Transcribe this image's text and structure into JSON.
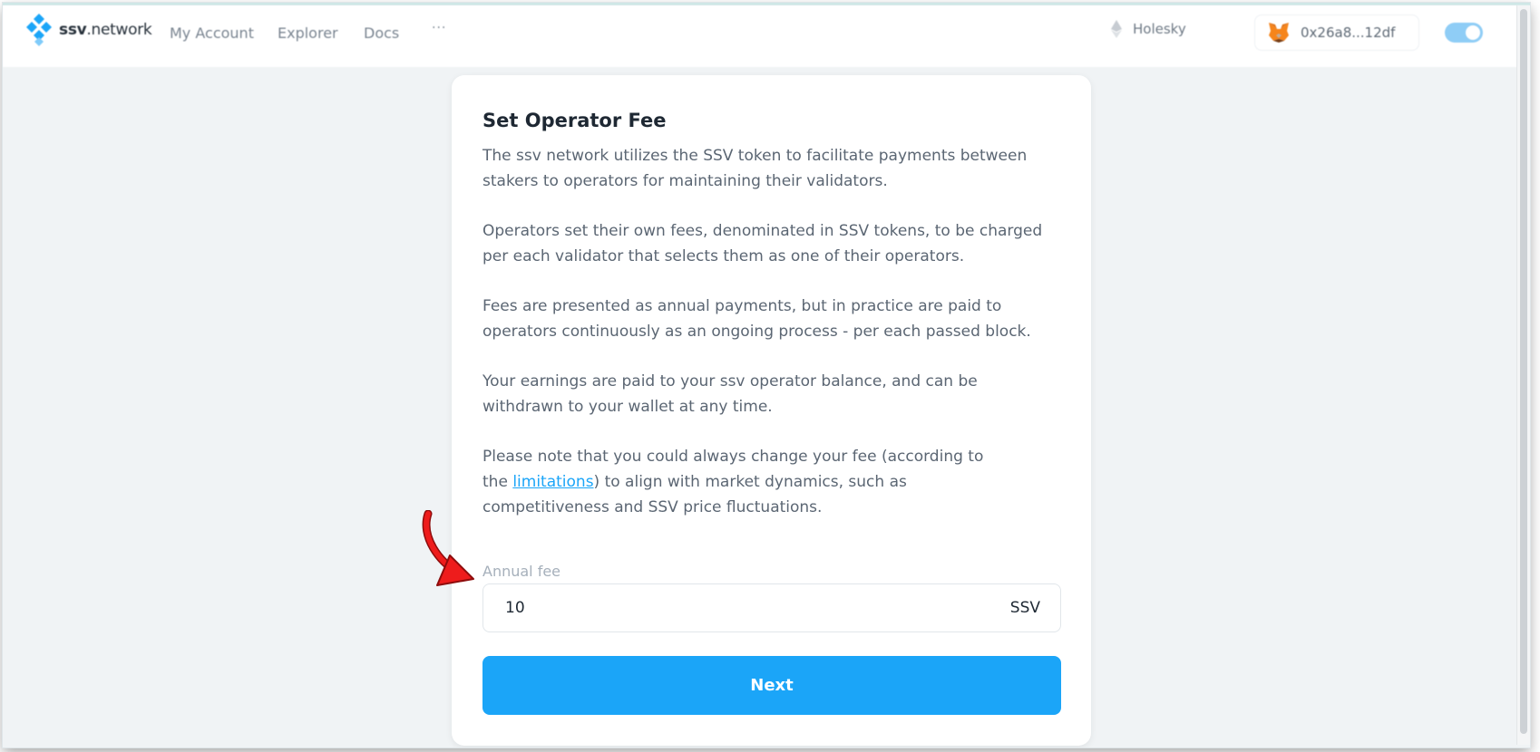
{
  "header": {
    "logo_bold": "ssv",
    "logo_rest": ".network",
    "nav": [
      "My Account",
      "Explorer",
      "Docs",
      "···"
    ],
    "network": "Holesky",
    "wallet_address": "0x26a8...12df"
  },
  "card": {
    "title": "Set Operator Fee",
    "paragraphs": [
      "The ssv network utilizes the SSV token to facilitate payments between stakers to operators for maintaining their validators.",
      "Operators set their own fees, denominated in SSV tokens, to be charged per each validator that selects them as one of their operators.",
      "Fees are presented as annual payments, but in practice are paid to operators continuously as an ongoing process - per each passed block.",
      "Your earnings are paid to your ssv operator balance, and can be withdrawn to your wallet at any time."
    ],
    "note": {
      "before": "Please note that you could always change your fee (according to the ",
      "link": "limitations",
      "after": ") to align with market dynamics, such as competitiveness and SSV price fluctuations."
    },
    "fee_label": "Annual fee",
    "fee_value": "10",
    "fee_unit": "SSV",
    "next_label": "Next"
  },
  "colors": {
    "accent": "#1ba5f8",
    "annotation_arrow": "#ee1c1c"
  }
}
